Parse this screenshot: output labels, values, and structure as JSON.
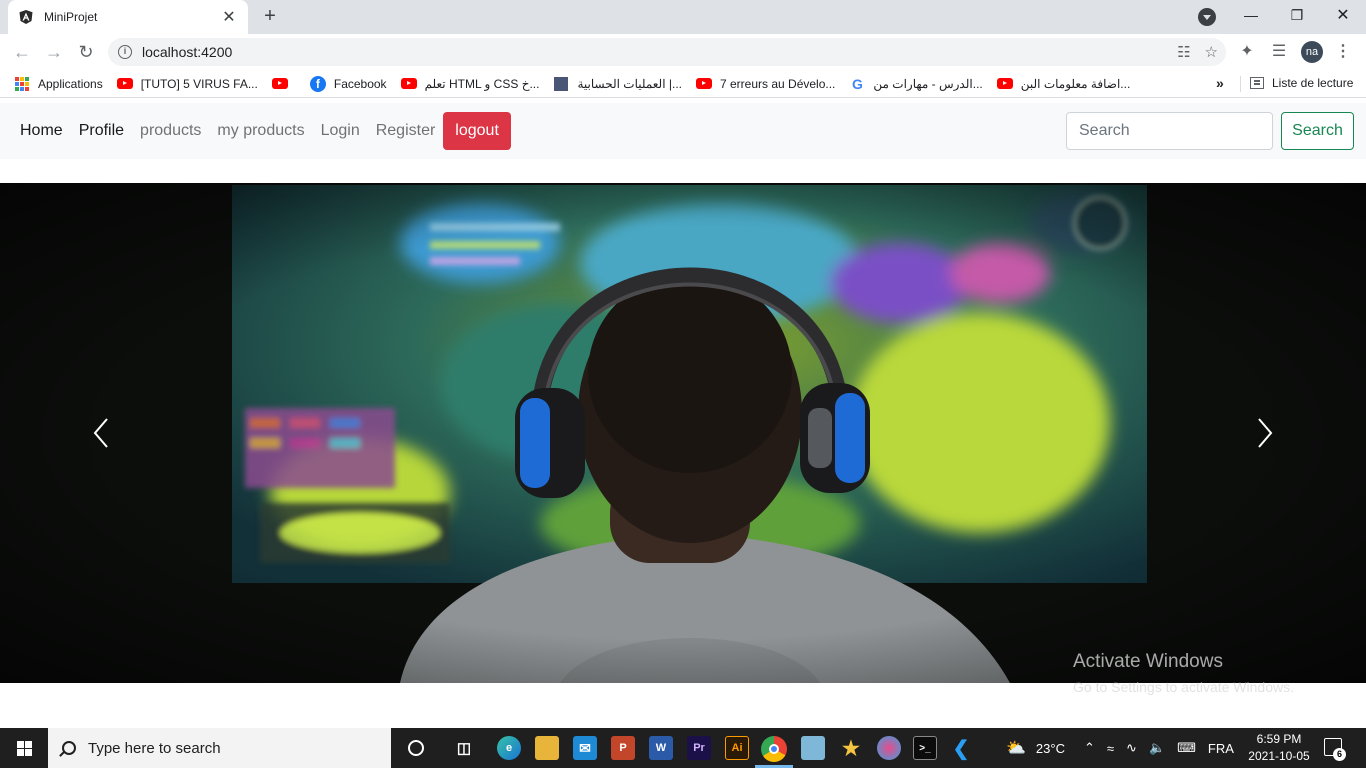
{
  "browser": {
    "tab_title": "MiniProjet",
    "url": "localhost:4200",
    "profile_initials": "na",
    "bookmarks": [
      {
        "label": "Applications",
        "icon": "apps-grid-icon"
      },
      {
        "label": "[TUTO] 5 VIRUS FA...",
        "icon": "youtube-icon"
      },
      {
        "label": "",
        "icon": "youtube-icon"
      },
      {
        "label": "Facebook",
        "icon": "facebook-icon"
      },
      {
        "label": "تعلم HTML و CSS خ...",
        "icon": "youtube-icon"
      },
      {
        "label": "العمليات الحسابية |...",
        "icon": "site-icon"
      },
      {
        "label": "7 erreurs au Dévelo...",
        "icon": "youtube-icon"
      },
      {
        "label": "الدرس - مهارات من...",
        "icon": "google-icon"
      },
      {
        "label": "اضافة معلومات البن...",
        "icon": "youtube-icon"
      }
    ],
    "more_bookmarks": "»",
    "reading_list": "Liste de lecture"
  },
  "navbar": {
    "links": [
      "Home",
      "Profile",
      "products",
      "my products",
      "Login",
      "Register"
    ],
    "logout_label": "logout",
    "search_placeholder": "Search",
    "search_button": "Search"
  },
  "carousel": {
    "prev_icon": "chevron-left-icon",
    "next_icon": "chevron-right-icon"
  },
  "watermark": {
    "title": "Activate Windows",
    "subtitle": "Go to Settings to activate Windows."
  },
  "taskbar": {
    "search_placeholder": "Type here to search",
    "weather": "23°C",
    "language": "FRA",
    "time": "6:59 PM",
    "date": "2021-10-05",
    "notification_count": "6"
  },
  "colors": {
    "logout_bg": "#dc3545",
    "search_green": "#198754",
    "navbar_bg": "#f8f9fa"
  }
}
